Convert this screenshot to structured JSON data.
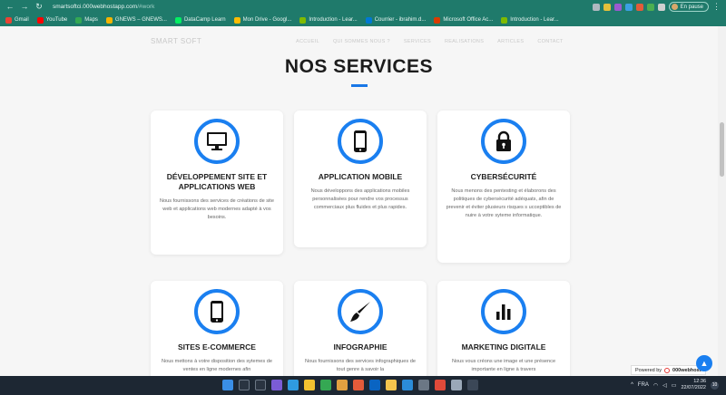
{
  "browser": {
    "url_main": "smartsoftci.000webhostapp.com",
    "url_rest": "/#work",
    "profile_label": "En pause",
    "bookmarks": [
      {
        "label": "Gmail",
        "color": "#ea4335"
      },
      {
        "label": "YouTube",
        "color": "#ff0000"
      },
      {
        "label": "Maps",
        "color": "#34a853"
      },
      {
        "label": "GNEWS – GNEWS...",
        "color": "#f4b400"
      },
      {
        "label": "DataCamp Learn",
        "color": "#03ef62"
      },
      {
        "label": "Mon Drive - Googl...",
        "color": "#fbbc04"
      },
      {
        "label": "Introduction - Lear...",
        "color": "#7fba00"
      },
      {
        "label": "Courrier - ibrahim.d...",
        "color": "#0078d4"
      },
      {
        "label": "Microsoft Office Ac...",
        "color": "#d83b01"
      },
      {
        "label": "Introduction - Lear...",
        "color": "#7fba00"
      }
    ]
  },
  "site": {
    "brand": "SMART SOFT",
    "menu": [
      "ACCUEIL",
      "QUI SOMMES NOUS ?",
      "SERVICES",
      "REALISATIONS",
      "ARTICLES",
      "CONTACT"
    ],
    "section_title": "NOS SERVICES",
    "accent_color": "#1a7ff0"
  },
  "services": [
    {
      "icon": "desktop-monitor-icon",
      "title": "DÉVELOPPEMENT SITE ET APPLICATIONS WEB",
      "text": "Nous fournissons des services de créations de site web et applications web modernes adapté à vos besoins."
    },
    {
      "icon": "mobile-phone-icon",
      "title": "APPLICATION MOBILE",
      "text": "Nous développons des applications mobiles personnalisées pour rendre vos processus commerciaux plus fluides et plus rapides."
    },
    {
      "icon": "lock-icon",
      "title": "CYBERSÉCURITÉ",
      "text": "Nous menons des pentesting et élaborons des politiques de cybersécurité adéquats, afin de prevenir et éviter plusieurs risques s ucceptibles de nuire à votre syteme informatique."
    },
    {
      "icon": "mobile-phone-icon",
      "title": "SITES E-COMMERCE",
      "text": "Nous mettons à votre disposition des sytemes de ventes en ligne modernes afin"
    },
    {
      "icon": "paintbrush-icon",
      "title": "INFOGRAPHIE",
      "text": "Nous fournissons des services infographiques de tout genre à savoir la"
    },
    {
      "icon": "bar-chart-icon",
      "title": "MARKETING DIGITALE",
      "text": "Nous vous créons une image et une présence importante en ligne à travers"
    }
  ],
  "footer": {
    "powered_label": "Powered by",
    "powered_brand": "000webhost"
  },
  "taskbar": {
    "lang": "FRA",
    "time": "12:36",
    "date": "22/07/2022",
    "notifications": "10"
  }
}
